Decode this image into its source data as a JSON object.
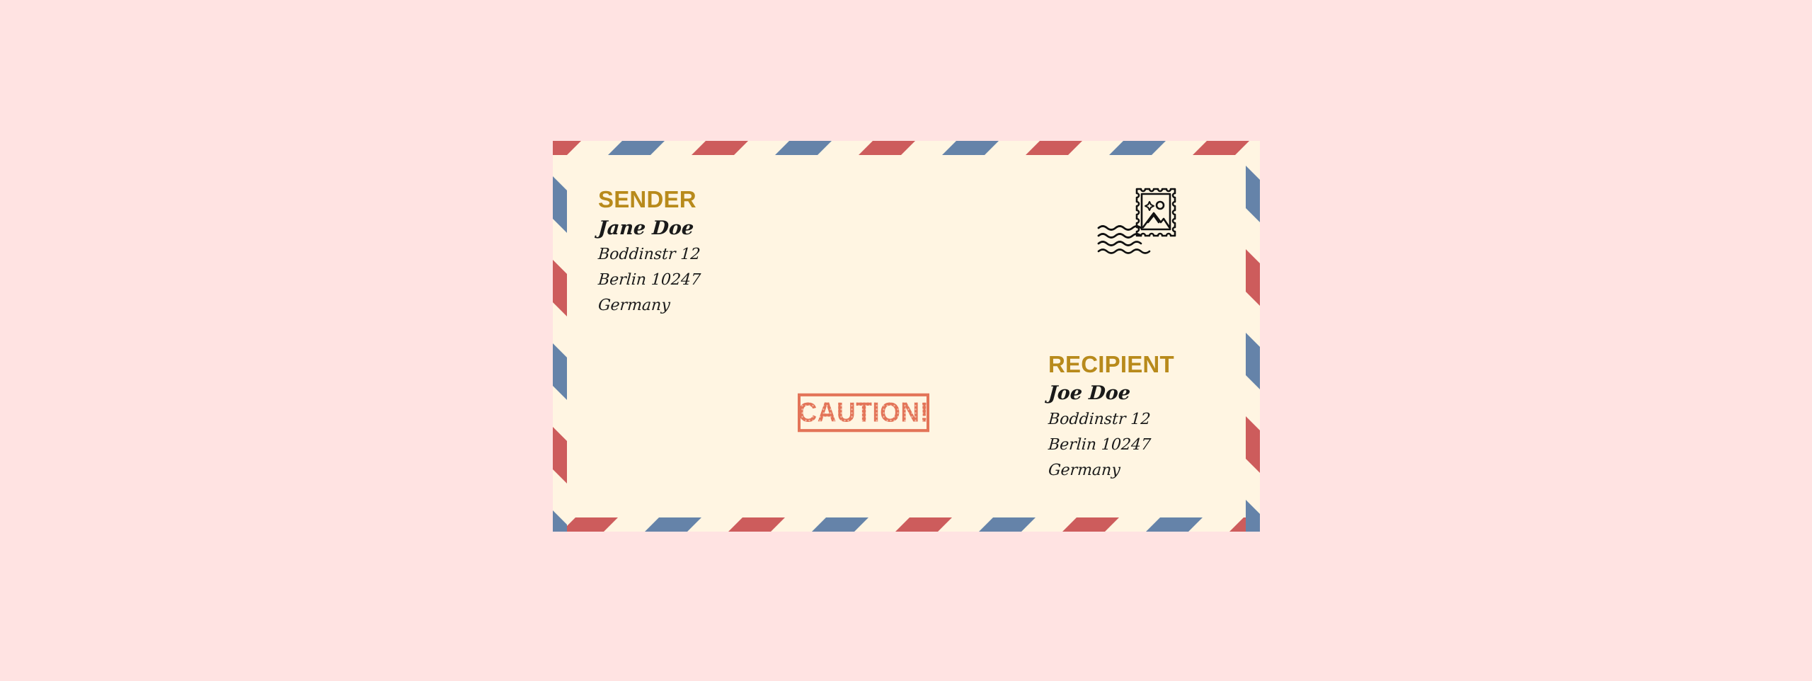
{
  "colors": {
    "background": "#ffe3e2",
    "envelope": "#fff5e2",
    "stripe_red": "#cd5c5c",
    "stripe_blue": "#6583a9",
    "label": "#b88a1b",
    "ink": "#1a1a1a",
    "stamp_ink": "#e0674a"
  },
  "sender": {
    "label": "SENDER",
    "name": "Jane Doe",
    "street": "Boddinstr 12",
    "city": "Berlin 10247",
    "country": "Germany"
  },
  "recipient": {
    "label": "RECIPIENT",
    "name": "Joe Doe",
    "street": "Boddinstr 12",
    "city": "Berlin 10247",
    "country": "Germany"
  },
  "stamp": {
    "icon": "postage-stamp-icon",
    "text": "CAUTION!"
  }
}
